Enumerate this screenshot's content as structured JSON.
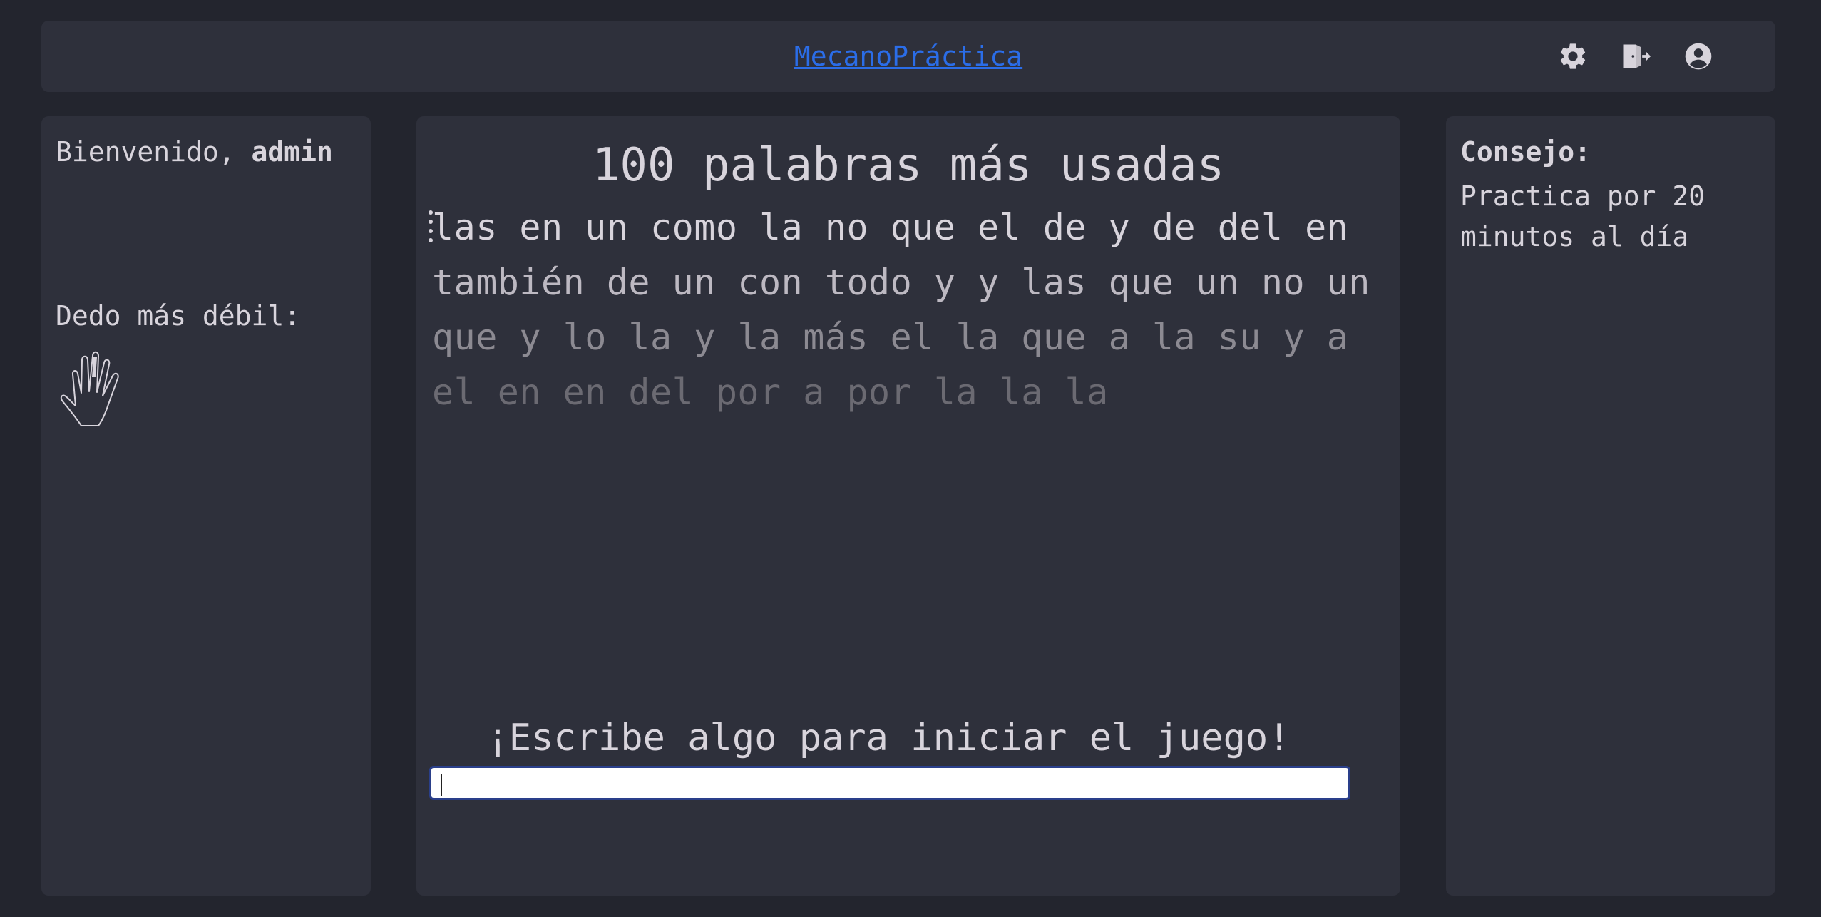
{
  "header": {
    "brand": "MecanoPráctica",
    "icons": [
      "gear-icon",
      "logout-icon",
      "user-circle-icon"
    ]
  },
  "left_panel": {
    "welcome_prefix": "Bienvenido, ",
    "username": "admin",
    "weak_finger_label": "Dedo más débil:",
    "weak_finger": "ring-finger"
  },
  "main": {
    "title": "100 palabras más usadas",
    "word_lines": [
      "las en un como la no que el de y de del en",
      "también de un con todo y y las que un no un",
      "que y lo la y la más el la que a la su y a",
      "el en en del por a por la la la"
    ],
    "start_message": "¡Escribe algo para iniciar el juego!",
    "input_value": ""
  },
  "right_panel": {
    "tip_title": "Consejo:",
    "tip_text": "Practica por 20 minutos al día"
  },
  "colors": {
    "background": "#23252e",
    "panel": "#2e303b",
    "text": "#d8d4dc",
    "link": "#2b6de8",
    "input_border": "#2a3f8a"
  }
}
